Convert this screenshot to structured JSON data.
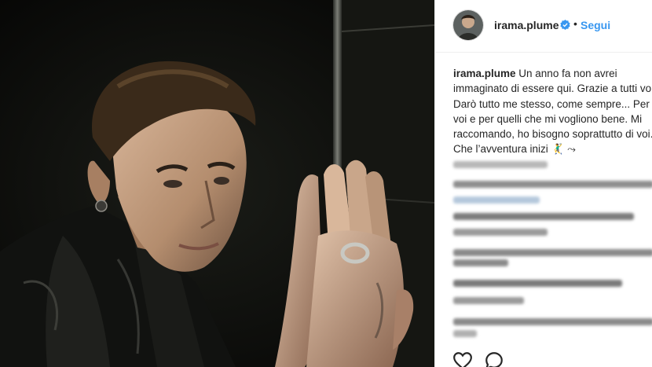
{
  "post": {
    "username": "irama.plume",
    "separator": "•",
    "follow_label": "Segui",
    "caption": {
      "username": "irama.plume",
      "lines": [
        " Un anno fa non avrei",
        "immaginato di essere qui. Grazie a tutti voi.",
        "Darò tutto me stesso, come sempre... Per",
        "voi e per quelli che mi vogliono bene. Mi",
        "raccomando, ho bisogno soprattutto di voi.",
        "Che l’avventura inizi 🤾‍♂️ ⤳"
      ]
    }
  },
  "colors": {
    "link": "#3897f0",
    "text": "#262626",
    "border": "#efefef",
    "verified": "#3897f0"
  },
  "icons": {
    "verified": "verified-badge-icon",
    "like": "heart-icon",
    "comment": "comment-bubble-icon"
  }
}
